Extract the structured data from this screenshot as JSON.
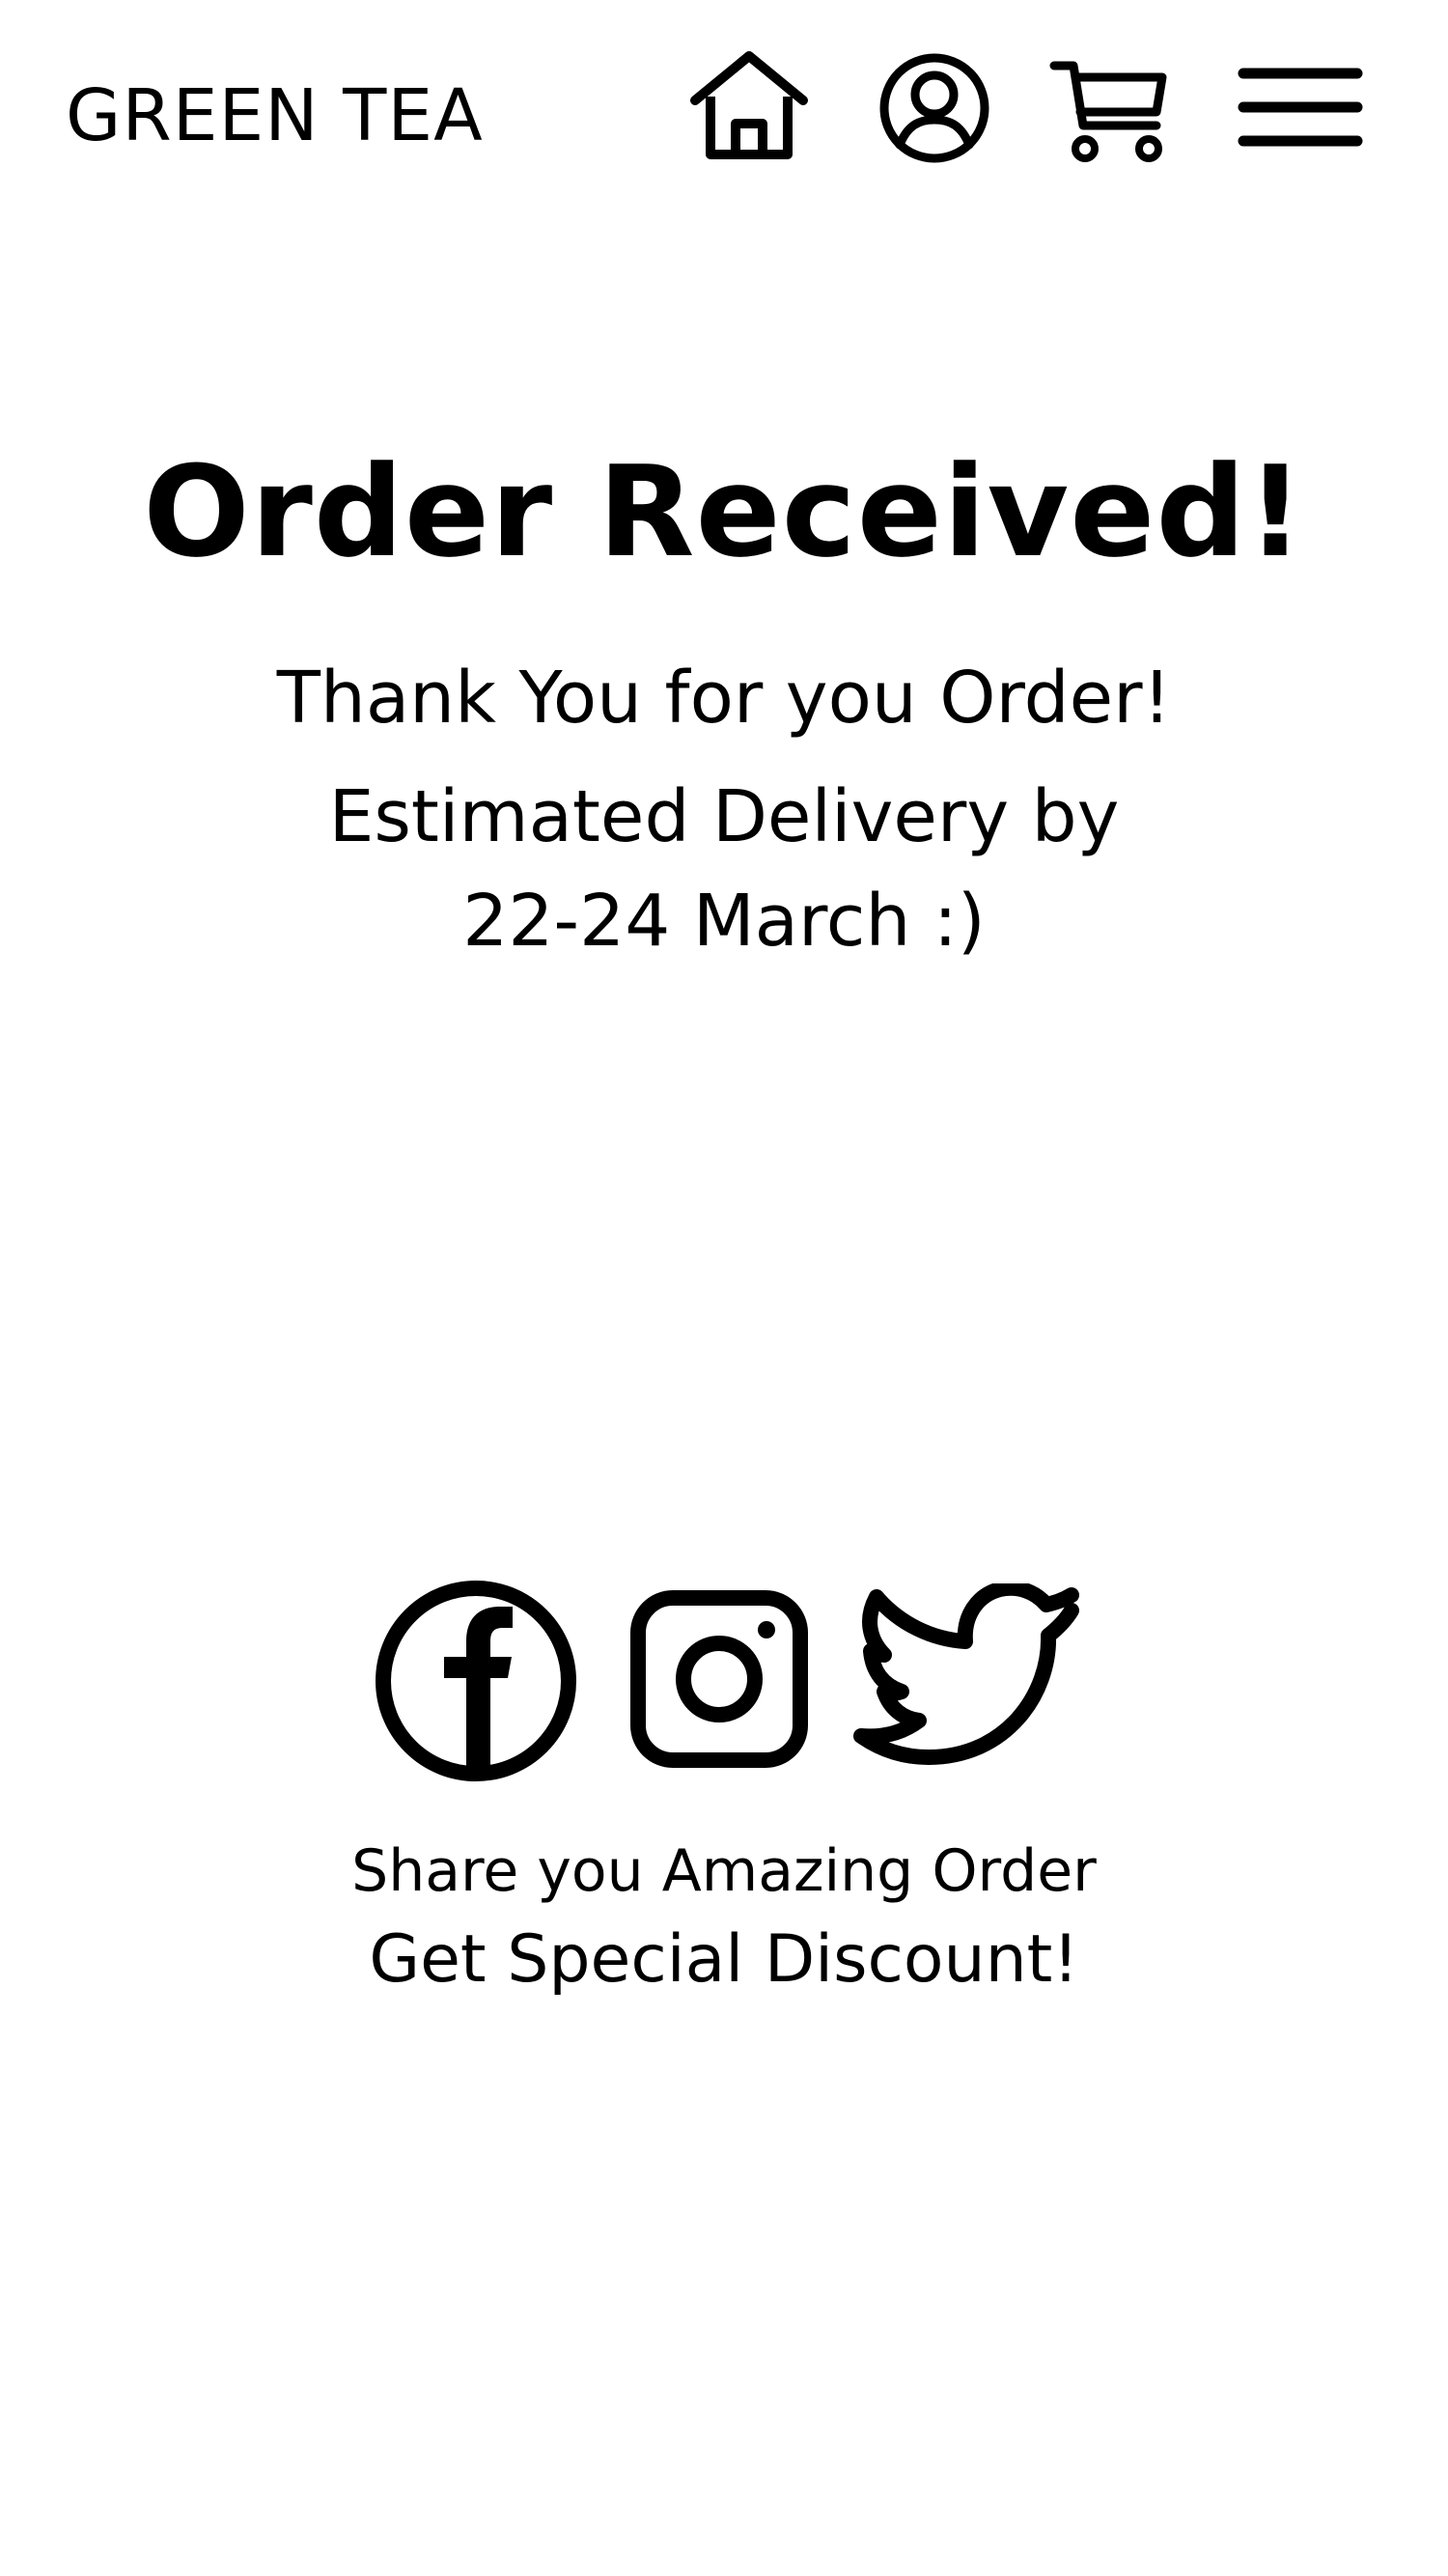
{
  "header": {
    "brand": "GREEN TEA",
    "icons": [
      "home-icon",
      "account-icon",
      "cart-icon",
      "menu-icon"
    ]
  },
  "confirmation": {
    "title": "Order Received!",
    "thank_you": "Thank You for you Order!",
    "delivery_line1": "Estimated Delivery by",
    "delivery_line2": "22-24 March :)"
  },
  "social": {
    "icons": [
      "facebook-icon",
      "instagram-icon",
      "twitter-icon"
    ],
    "share_text": "Share you Amazing Order",
    "discount_text": "Get Special Discount!"
  },
  "colors": {
    "text": "#000000",
    "background": "#ffffff"
  }
}
